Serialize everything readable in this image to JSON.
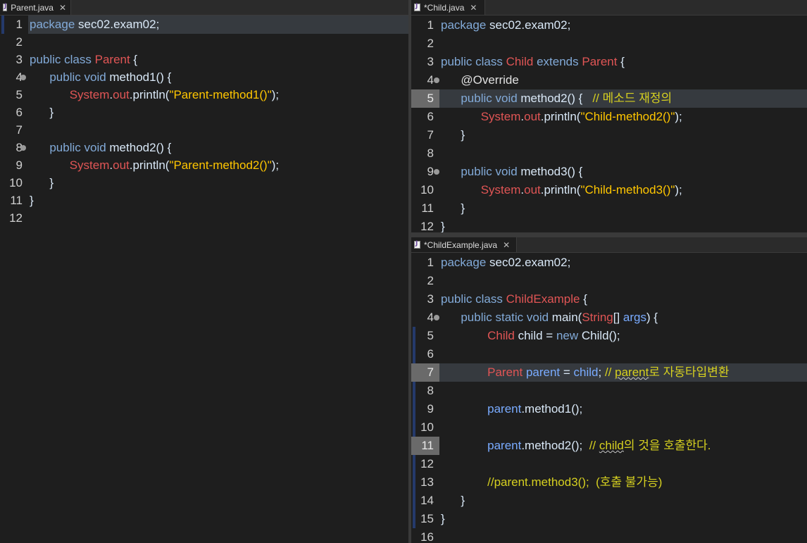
{
  "editors": {
    "parent": {
      "tab_label": "Parent.java",
      "lines": [
        "package sec02.exam02;",
        "",
        "public class Parent {",
        "    public void method1() {",
        "        System.out.println(\"Parent-method1()\");",
        "    }",
        "",
        "    public void method2() {",
        "        System.out.println(\"Parent-method2()\");",
        "    }",
        "}",
        ""
      ]
    },
    "child": {
      "tab_label": "*Child.java",
      "lines": [
        "package sec02.exam02;",
        "",
        "public class Child extends Parent {",
        "    @Override",
        "    public void method2() {   // 메소드 재정의",
        "        System.out.println(\"Child-method2()\");",
        "    }",
        "",
        "    public void method3() {",
        "        System.out.println(\"Child-method3()\");",
        "    }",
        "}"
      ]
    },
    "example": {
      "tab_label": "*ChildExample.java",
      "lines": [
        "package sec02.exam02;",
        "",
        "public class ChildExample {",
        "    public static void main(String[] args) {",
        "        Child child = new Child();",
        "",
        "        Parent parent = child; // parent로 자동타입변환",
        "",
        "        parent.method1();",
        "",
        "        parent.method2();  // child의 것을 호출한다.",
        "",
        "        //parent.method3();  (호출 불가능)",
        "    }",
        "}",
        ""
      ]
    }
  },
  "icons": {
    "file": "java-file-icon",
    "close": "close-icon",
    "fold": "fold-marker-icon",
    "override": "override-triangle-icon"
  },
  "colors": {
    "background": "#1e1e1e",
    "keyword": "#cc6c1d",
    "class_name": "#e05555",
    "string": "#ffc600",
    "comment": "#d6d020",
    "text": "#d9e8f7"
  }
}
